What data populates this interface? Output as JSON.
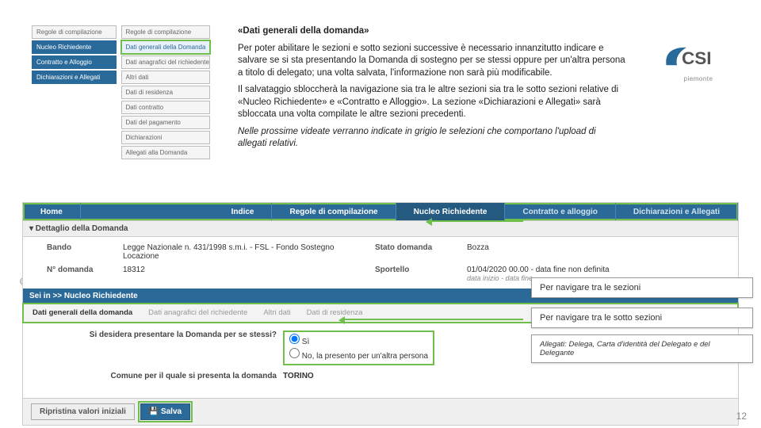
{
  "mini_sidebar": {
    "left": [
      {
        "label": "Regole di compilazione",
        "cls": ""
      },
      {
        "label": "Nucleo Richiedente",
        "cls": "primary"
      },
      {
        "label": "Contratto e Alloggio",
        "cls": "primary"
      },
      {
        "label": "Dichiarazioni e Allegati",
        "cls": "primary"
      }
    ],
    "right": [
      {
        "label": "Regole di compilazione",
        "cls": ""
      },
      {
        "label": "Dati generali della Domanda",
        "cls": "highlight green-hl"
      },
      {
        "label": "Dati anagrafici del richiedente",
        "cls": ""
      },
      {
        "label": "Altri dati",
        "cls": ""
      },
      {
        "label": "Dati di residenza",
        "cls": ""
      },
      {
        "label": "Dati contratto",
        "cls": ""
      },
      {
        "label": "Dati del pagamento",
        "cls": ""
      },
      {
        "label": "Dichiarazioni",
        "cls": ""
      },
      {
        "label": "Allegati alla Domanda",
        "cls": ""
      }
    ]
  },
  "explain": {
    "title": "«Dati generali della domanda»",
    "p1": "Per poter abilitare le sezioni e sotto sezioni successive è necessario innanzitutto indicare e salvare se si sta presentando la Domanda di sostegno per se stessi oppure per un'altra persona a titolo di delegato; una volta salvata, l'informazione non sarà più modificabile.",
    "p2": "Il salvataggio sbloccherà la navigazione sia tra le altre sezioni sia tra le sotto sezioni relative di «Nucleo Richiedente» e «Contratto e Alloggio». La sezione «Dichiarazioni e Allegati» sarà sbloccata una volta compilate le altre sezioni precedenti.",
    "note": "Nelle prossime videate verranno indicate in grigio le selezioni che comportano l'upload di allegati relativi."
  },
  "logo": {
    "brand": "CSI",
    "caption": "piemonte"
  },
  "app": {
    "nav": {
      "home": "Home",
      "indice": "Indice",
      "regole": "Regole di compilazione",
      "nucleo": "Nucleo Richiedente",
      "contratto": "Contratto e alloggio",
      "dich": "Dichiarazioni e Allegati"
    },
    "detail_head": "▾ Dettaglio della Domanda",
    "meta": {
      "bando_lbl": "Bando",
      "bando_val": "Legge Nazionale n. 431/1998 s.m.i. - FSL - Fondo Sostegno Locazione",
      "stato_lbl": "Stato domanda",
      "stato_val": "Bozza",
      "num_lbl": "N° domanda",
      "num_val": "18312",
      "sportello_lbl": "Sportello",
      "sportello_val": "01/04/2020 00.00 - data fine non definita",
      "sportello_sub": "data inizio - data fine"
    },
    "breadcrumb": "Sei in >> Nucleo Richiedente",
    "subtabs": {
      "t1": "Dati generali della domanda",
      "t2": "Dati anagrafici del richiedente",
      "t3": "Altri dati",
      "t4": "Dati di residenza"
    },
    "form": {
      "q1": "Si desidera presentare la Domanda per se stessi?",
      "opt_si": "Sì",
      "opt_no": "No, la presento per un'altra persona",
      "q2": "Comune per il quale si presenta la domanda",
      "comune": "TORINO"
    },
    "buttons": {
      "reset": "Ripristina valori iniziali",
      "save": "Salva"
    }
  },
  "callouts": {
    "c1": "Per navigare tra le sezioni",
    "c2": "Per navigare tra le sotto sezioni",
    "c3_lead": "Allegati:",
    "c3_rest": " Delega, Carta d'identità del Delegato e del Delegante"
  },
  "page_num": "12"
}
